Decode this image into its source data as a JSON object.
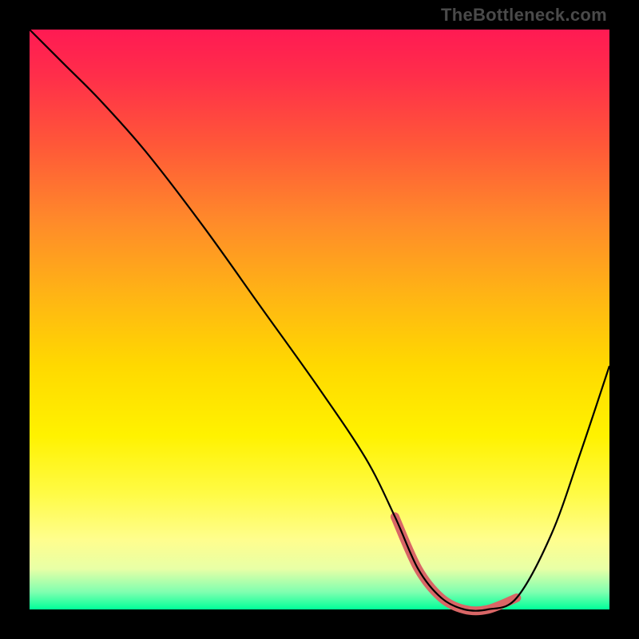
{
  "watermark": "TheBottleneck.com",
  "chart_data": {
    "type": "line",
    "title": "",
    "xlabel": "",
    "ylabel": "",
    "xlim": [
      0,
      100
    ],
    "ylim": [
      0,
      100
    ],
    "x": [
      0,
      6,
      12,
      20,
      30,
      40,
      50,
      58,
      63,
      67,
      71,
      75,
      79,
      84,
      90,
      95,
      100
    ],
    "values": [
      100,
      94,
      88,
      79,
      66,
      52,
      38,
      26,
      16,
      7,
      2,
      0,
      0,
      2,
      13,
      27,
      42
    ],
    "trough_marker": {
      "x_start": 63,
      "x_end": 84,
      "color": "#d96666"
    },
    "gradient_stops": [
      {
        "pos": 0,
        "color": "#ff1a53"
      },
      {
        "pos": 20,
        "color": "#ff5838"
      },
      {
        "pos": 46,
        "color": "#ffd900"
      },
      {
        "pos": 80,
        "color": "#fffb45"
      },
      {
        "pos": 100,
        "color": "#00ff99"
      }
    ]
  }
}
